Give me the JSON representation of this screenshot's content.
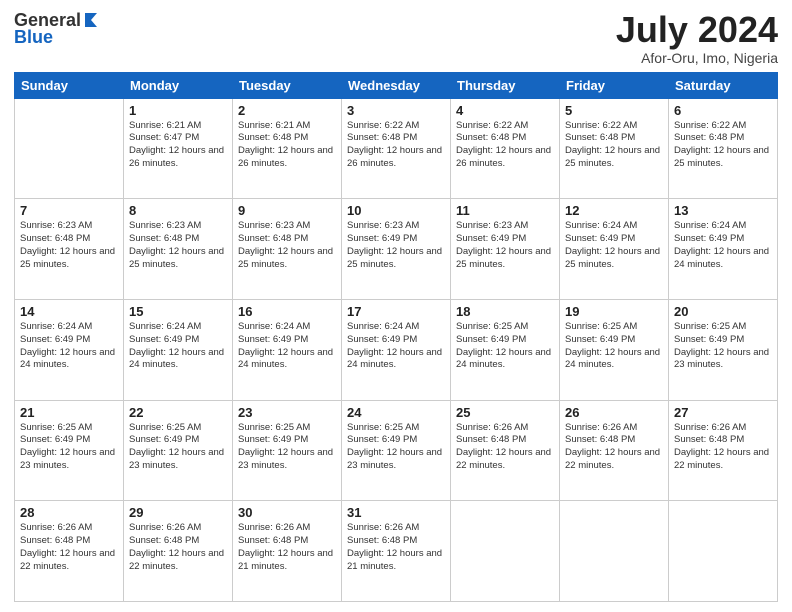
{
  "logo": {
    "line1": "General",
    "line2": "Blue"
  },
  "header": {
    "month": "July 2024",
    "location": "Afor-Oru, Imo, Nigeria"
  },
  "weekdays": [
    "Sunday",
    "Monday",
    "Tuesday",
    "Wednesday",
    "Thursday",
    "Friday",
    "Saturday"
  ],
  "weeks": [
    [
      {
        "day": "",
        "sunrise": "",
        "sunset": "",
        "daylight": ""
      },
      {
        "day": "1",
        "sunrise": "Sunrise: 6:21 AM",
        "sunset": "Sunset: 6:47 PM",
        "daylight": "Daylight: 12 hours and 26 minutes."
      },
      {
        "day": "2",
        "sunrise": "Sunrise: 6:21 AM",
        "sunset": "Sunset: 6:48 PM",
        "daylight": "Daylight: 12 hours and 26 minutes."
      },
      {
        "day": "3",
        "sunrise": "Sunrise: 6:22 AM",
        "sunset": "Sunset: 6:48 PM",
        "daylight": "Daylight: 12 hours and 26 minutes."
      },
      {
        "day": "4",
        "sunrise": "Sunrise: 6:22 AM",
        "sunset": "Sunset: 6:48 PM",
        "daylight": "Daylight: 12 hours and 26 minutes."
      },
      {
        "day": "5",
        "sunrise": "Sunrise: 6:22 AM",
        "sunset": "Sunset: 6:48 PM",
        "daylight": "Daylight: 12 hours and 25 minutes."
      },
      {
        "day": "6",
        "sunrise": "Sunrise: 6:22 AM",
        "sunset": "Sunset: 6:48 PM",
        "daylight": "Daylight: 12 hours and 25 minutes."
      }
    ],
    [
      {
        "day": "7",
        "sunrise": "Sunrise: 6:23 AM",
        "sunset": "Sunset: 6:48 PM",
        "daylight": "Daylight: 12 hours and 25 minutes."
      },
      {
        "day": "8",
        "sunrise": "Sunrise: 6:23 AM",
        "sunset": "Sunset: 6:48 PM",
        "daylight": "Daylight: 12 hours and 25 minutes."
      },
      {
        "day": "9",
        "sunrise": "Sunrise: 6:23 AM",
        "sunset": "Sunset: 6:48 PM",
        "daylight": "Daylight: 12 hours and 25 minutes."
      },
      {
        "day": "10",
        "sunrise": "Sunrise: 6:23 AM",
        "sunset": "Sunset: 6:49 PM",
        "daylight": "Daylight: 12 hours and 25 minutes."
      },
      {
        "day": "11",
        "sunrise": "Sunrise: 6:23 AM",
        "sunset": "Sunset: 6:49 PM",
        "daylight": "Daylight: 12 hours and 25 minutes."
      },
      {
        "day": "12",
        "sunrise": "Sunrise: 6:24 AM",
        "sunset": "Sunset: 6:49 PM",
        "daylight": "Daylight: 12 hours and 25 minutes."
      },
      {
        "day": "13",
        "sunrise": "Sunrise: 6:24 AM",
        "sunset": "Sunset: 6:49 PM",
        "daylight": "Daylight: 12 hours and 24 minutes."
      }
    ],
    [
      {
        "day": "14",
        "sunrise": "Sunrise: 6:24 AM",
        "sunset": "Sunset: 6:49 PM",
        "daylight": "Daylight: 12 hours and 24 minutes."
      },
      {
        "day": "15",
        "sunrise": "Sunrise: 6:24 AM",
        "sunset": "Sunset: 6:49 PM",
        "daylight": "Daylight: 12 hours and 24 minutes."
      },
      {
        "day": "16",
        "sunrise": "Sunrise: 6:24 AM",
        "sunset": "Sunset: 6:49 PM",
        "daylight": "Daylight: 12 hours and 24 minutes."
      },
      {
        "day": "17",
        "sunrise": "Sunrise: 6:24 AM",
        "sunset": "Sunset: 6:49 PM",
        "daylight": "Daylight: 12 hours and 24 minutes."
      },
      {
        "day": "18",
        "sunrise": "Sunrise: 6:25 AM",
        "sunset": "Sunset: 6:49 PM",
        "daylight": "Daylight: 12 hours and 24 minutes."
      },
      {
        "day": "19",
        "sunrise": "Sunrise: 6:25 AM",
        "sunset": "Sunset: 6:49 PM",
        "daylight": "Daylight: 12 hours and 24 minutes."
      },
      {
        "day": "20",
        "sunrise": "Sunrise: 6:25 AM",
        "sunset": "Sunset: 6:49 PM",
        "daylight": "Daylight: 12 hours and 23 minutes."
      }
    ],
    [
      {
        "day": "21",
        "sunrise": "Sunrise: 6:25 AM",
        "sunset": "Sunset: 6:49 PM",
        "daylight": "Daylight: 12 hours and 23 minutes."
      },
      {
        "day": "22",
        "sunrise": "Sunrise: 6:25 AM",
        "sunset": "Sunset: 6:49 PM",
        "daylight": "Daylight: 12 hours and 23 minutes."
      },
      {
        "day": "23",
        "sunrise": "Sunrise: 6:25 AM",
        "sunset": "Sunset: 6:49 PM",
        "daylight": "Daylight: 12 hours and 23 minutes."
      },
      {
        "day": "24",
        "sunrise": "Sunrise: 6:25 AM",
        "sunset": "Sunset: 6:49 PM",
        "daylight": "Daylight: 12 hours and 23 minutes."
      },
      {
        "day": "25",
        "sunrise": "Sunrise: 6:26 AM",
        "sunset": "Sunset: 6:48 PM",
        "daylight": "Daylight: 12 hours and 22 minutes."
      },
      {
        "day": "26",
        "sunrise": "Sunrise: 6:26 AM",
        "sunset": "Sunset: 6:48 PM",
        "daylight": "Daylight: 12 hours and 22 minutes."
      },
      {
        "day": "27",
        "sunrise": "Sunrise: 6:26 AM",
        "sunset": "Sunset: 6:48 PM",
        "daylight": "Daylight: 12 hours and 22 minutes."
      }
    ],
    [
      {
        "day": "28",
        "sunrise": "Sunrise: 6:26 AM",
        "sunset": "Sunset: 6:48 PM",
        "daylight": "Daylight: 12 hours and 22 minutes."
      },
      {
        "day": "29",
        "sunrise": "Sunrise: 6:26 AM",
        "sunset": "Sunset: 6:48 PM",
        "daylight": "Daylight: 12 hours and 22 minutes."
      },
      {
        "day": "30",
        "sunrise": "Sunrise: 6:26 AM",
        "sunset": "Sunset: 6:48 PM",
        "daylight": "Daylight: 12 hours and 21 minutes."
      },
      {
        "day": "31",
        "sunrise": "Sunrise: 6:26 AM",
        "sunset": "Sunset: 6:48 PM",
        "daylight": "Daylight: 12 hours and 21 minutes."
      },
      {
        "day": "",
        "sunrise": "",
        "sunset": "",
        "daylight": ""
      },
      {
        "day": "",
        "sunrise": "",
        "sunset": "",
        "daylight": ""
      },
      {
        "day": "",
        "sunrise": "",
        "sunset": "",
        "daylight": ""
      }
    ]
  ]
}
